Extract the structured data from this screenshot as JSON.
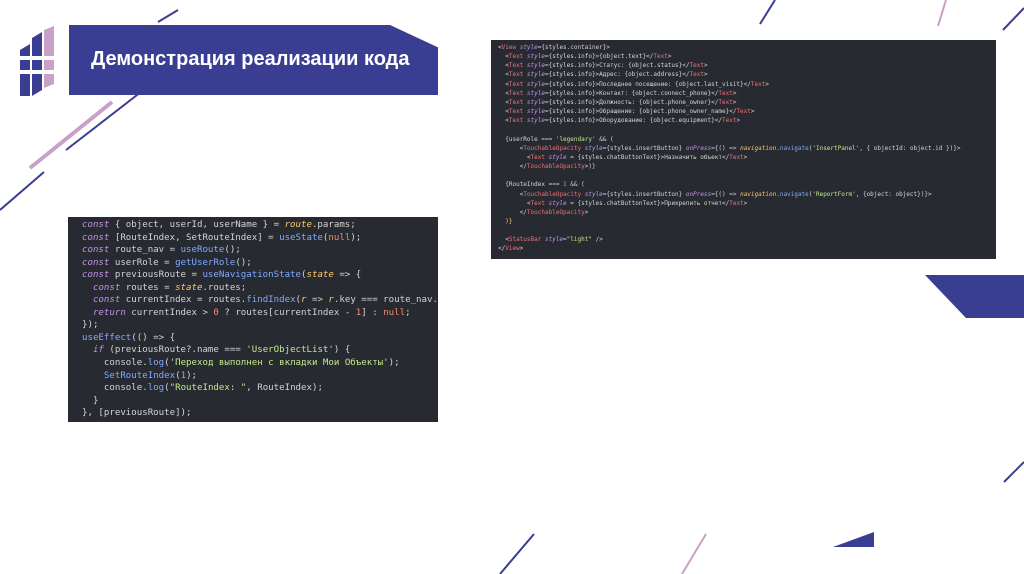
{
  "slide": {
    "title": "Демонстрация реализации кода"
  },
  "code_left": {
    "lines": [
      "const { object, userId, userName } = route.params;",
      "const [RouteIndex, SetRouteIndex] = useState(null);",
      "const route_nav = useRoute();",
      "const userRole = getUserRole();",
      "const previousRoute = useNavigationState(state => {",
      "  const routes = state.routes;",
      "  const currentIndex = routes.findIndex(r => r.key === route_nav.key);",
      "  return currentIndex > 0 ? routes[currentIndex - 1] : null;",
      "});",
      "useEffect(() => {",
      "  if (previousRoute?.name === 'UserObjectList') {",
      "    console.log('Переход выполнен с вкладки Мои Объекты');",
      "    SetRouteIndex(1);",
      "    console.log(\"RouteIndex: \", RouteIndex);",
      "  }",
      "}, [previousRoute]);"
    ]
  },
  "code_right": {
    "lines": [
      "<View style={styles.container}>",
      "  <Text style={styles.info}>{object.text}</Text>",
      "  <Text style={styles.info}>Статус: {object.status}</Text>",
      "  <Text style={styles.info}>Адрес: {object.address}</Text>",
      "  <Text style={styles.info}>Последнее посещение: {object.last_visit}</Text>",
      "  <Text style={styles.info}>Контакт: {object.connect_phone}</Text>",
      "  <Text style={styles.info}>Должность: {object.phone_owner}</Text>",
      "  <Text style={styles.info}>Обращение: {object.phone_owner_name}</Text>",
      "  <Text style={styles.info}>Оборудование: {object.equipment}</Text>",
      "",
      "  {userRole === 'legendary' && (",
      "      <TouchableOpacity style={styles.insertButton} onPress={() => navigation.navigate('InsertPanel', { objectId: object.id })}>",
      "        <Text style = {styles.chatButtonText}>Назначить объект</Text>",
      "      </TouchableOpacity>)}",
      "",
      "  {RouteIndex === 1 && (",
      "      <TouchableOpacity style={styles.insertButton} onPress={() => navigation.navigate('ReportForm', {object: object})}>",
      "        <Text style = {styles.chatButtonText}>Прикрепить отчет</Text>",
      "      </TouchableOpacity>",
      "  )}",
      "",
      "  <StatusBar style=\"light\" />",
      "</View>"
    ]
  },
  "colors": {
    "title_bar": "#3a3e93",
    "code_bg": "#272a30",
    "accent_blue": "#3a3e93",
    "accent_pink": "#c9a0c8"
  }
}
